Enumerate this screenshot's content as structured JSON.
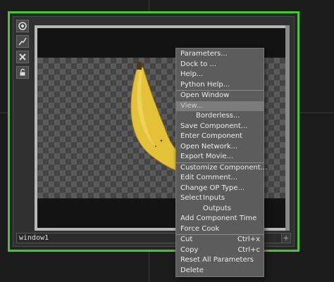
{
  "node": {
    "name": "window1",
    "plus_label": "+"
  },
  "toolbar": {
    "icons": [
      "target-icon",
      "lightning-icon",
      "close-icon",
      "lock-icon"
    ]
  },
  "menu": {
    "items": [
      {
        "label": "Parameters..."
      },
      {
        "label": "Dock to ..."
      },
      {
        "label": "Help..."
      },
      {
        "label": "Python Help..."
      },
      {
        "label": "Open Window"
      },
      {
        "label": "View..."
      },
      {
        "label": "Borderless..."
      },
      {
        "label": "Save Component..."
      },
      {
        "label": "Enter Component"
      },
      {
        "label": "Open Network..."
      },
      {
        "label": "Export Movie..."
      },
      {
        "label": "Customize Component..."
      },
      {
        "label": "Edit Comment..."
      },
      {
        "label": "Change OP Type..."
      },
      {
        "label": "Select"
      },
      {
        "label": "Inputs"
      },
      {
        "label": "Outputs"
      },
      {
        "label": "Add Component Time"
      },
      {
        "label": "Force Cook"
      },
      {
        "label": "Cut",
        "shortcut": "Ctrl+x"
      },
      {
        "label": "Copy",
        "shortcut": "Ctrl+c"
      },
      {
        "label": "Reset All Parameters"
      },
      {
        "label": "Delete"
      }
    ]
  },
  "colors": {
    "selection_border": "#49c43b",
    "menu_bg": "#5c5c5c",
    "menu_highlight": "#7c7c7c"
  }
}
